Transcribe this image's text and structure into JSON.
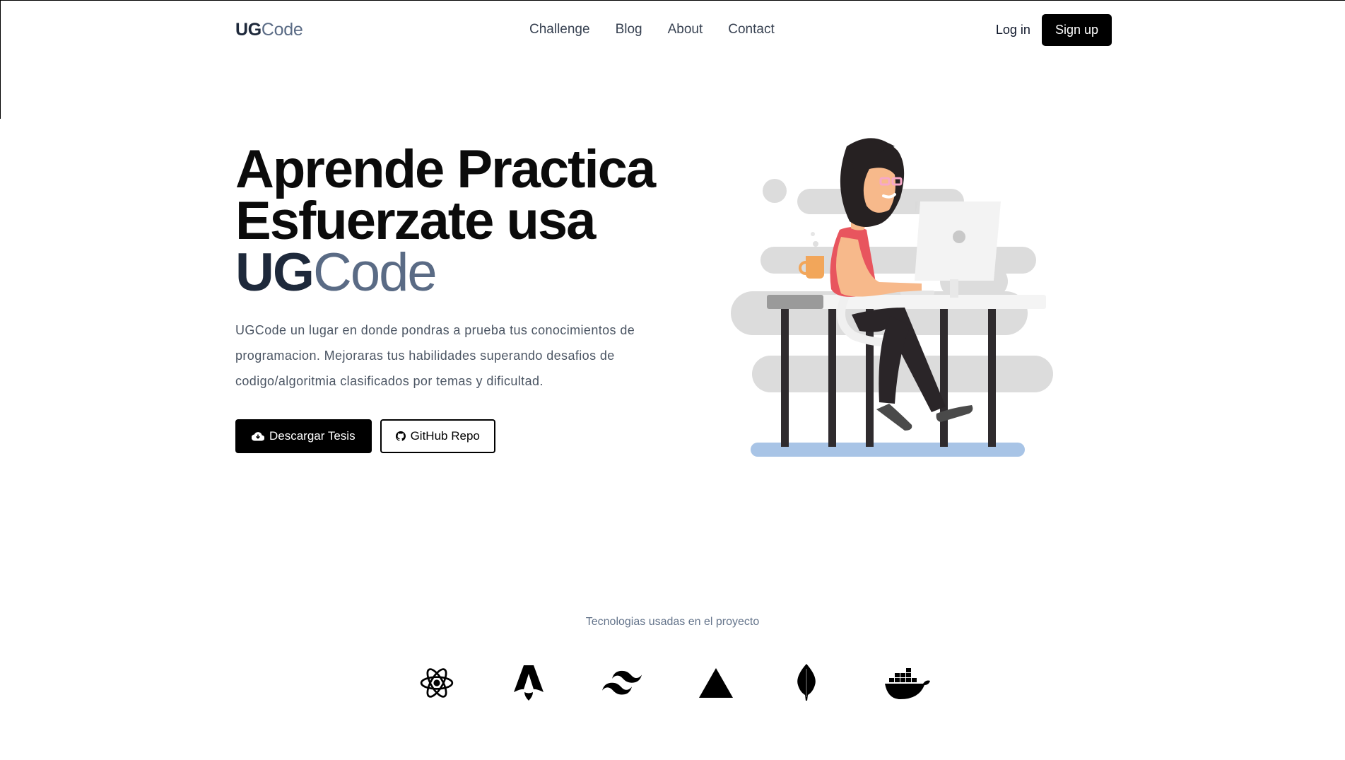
{
  "header": {
    "logo_bold": "UG",
    "logo_light": "Code",
    "nav": [
      "Challenge",
      "Blog",
      "About",
      "Contact"
    ],
    "login_label": "Log in",
    "signup_label": "Sign up"
  },
  "hero": {
    "line1": "Aprende Practica",
    "line2": "Esfuerzate usa",
    "brand_bold": "UG",
    "brand_light": "Code",
    "description": "UGCode un lugar en donde pondras a prueba tus conocimientos de programacion. Mejoraras tus habilidades superando desafios de codigo/algoritmia clasificados por temas y dificultad.",
    "primary_button": "Descargar Tesis",
    "secondary_button": "GitHub Repo"
  },
  "technologies": {
    "title": "Tecnologias usadas en el proyecto",
    "icons": [
      "react-icon",
      "astro-icon",
      "tailwind-icon",
      "vercel-icon",
      "mongodb-icon",
      "docker-icon"
    ]
  },
  "colors": {
    "brand_dark": "#1e293b",
    "brand_light": "#5a6b85",
    "button_dark": "#000000",
    "text_muted": "#4b5563"
  }
}
